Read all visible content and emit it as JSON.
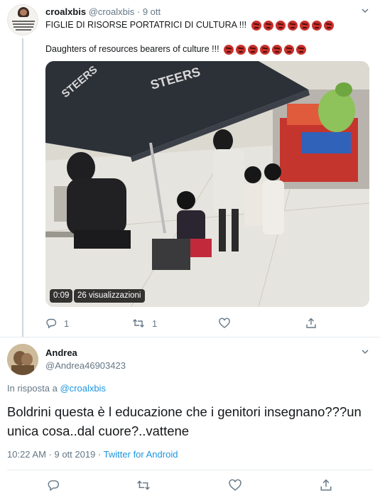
{
  "tweet1": {
    "display_name": "croalxbis",
    "handle": "@croalxbis",
    "separator": "·",
    "time": "9 ott",
    "text_it": "FIGLIE DI RISORSE PORTATRICI DI CULTURA !!!",
    "text_en": "Daughters of resources bearers of culture !!!",
    "emoji_name": "cursing-face-emoji",
    "emoji_count": 7,
    "video": {
      "duration": "0:09",
      "views": "26 visualizzazioni",
      "umbrella_brand": "STEERS"
    },
    "actions": {
      "replies": "1",
      "retweets": "1"
    }
  },
  "tweet2": {
    "display_name": "Andrea",
    "handle": "@Andrea46903423",
    "reply_prefix": "In risposta a",
    "reply_target": "@croalxbis",
    "text": "Boldrini questa è l educazione che i genitori insegnano???un unica cosa..dal cuore?..vattene",
    "timestamp": "10:22 AM · 9 ott 2019",
    "meta_separator": "·",
    "source": "Twitter for Android"
  },
  "colors": {
    "accent": "#1b95e0",
    "muted": "#657786",
    "text": "#14171a",
    "border": "#e6ecf0",
    "emoji": "#c9312c"
  }
}
